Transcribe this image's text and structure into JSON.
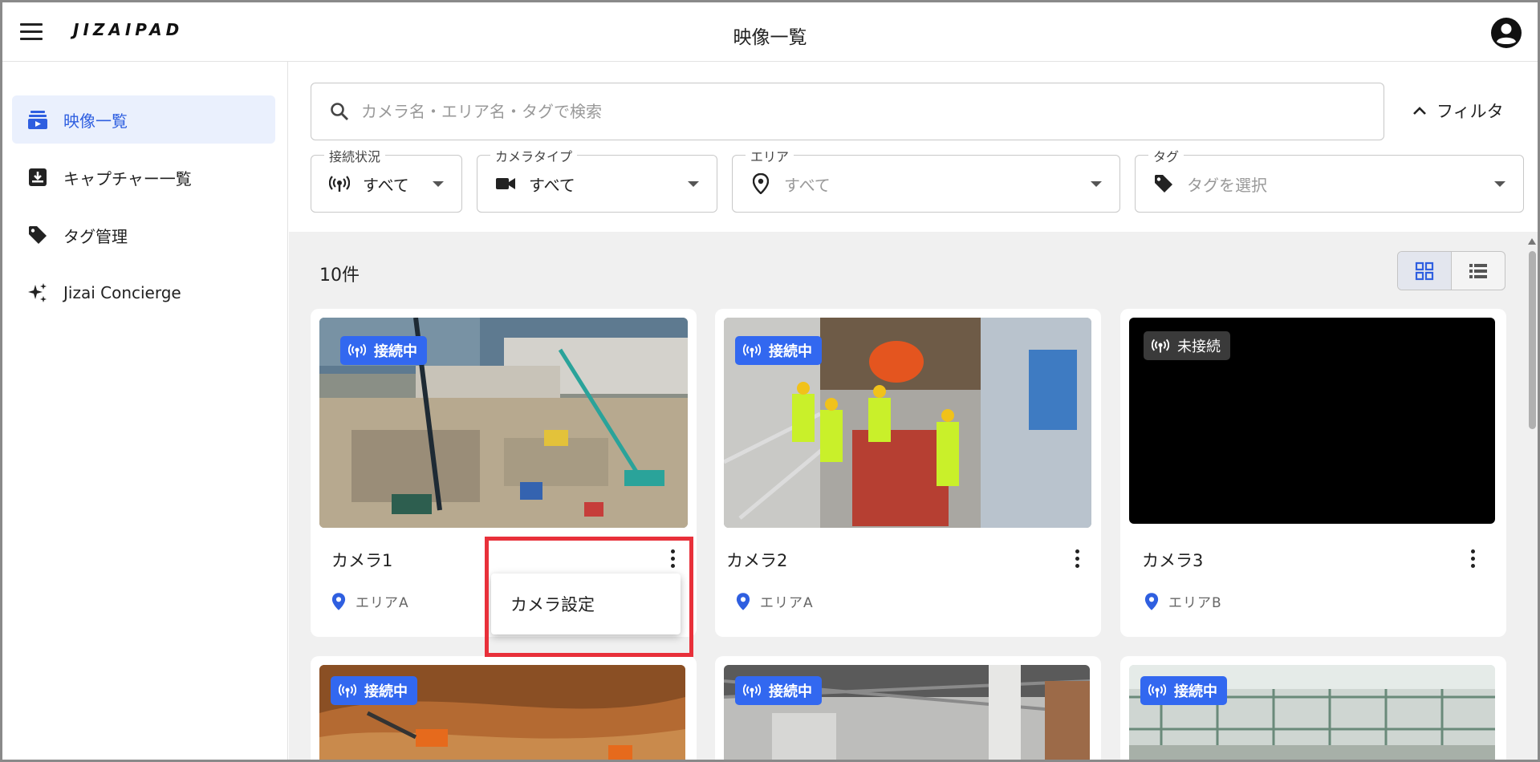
{
  "header": {
    "logo": "JIZAIPAD",
    "title": "映像一覧"
  },
  "sidebar": {
    "items": [
      {
        "label": "映像一覧",
        "icon": "video-list-icon",
        "active": true
      },
      {
        "label": "キャプチャー一覧",
        "icon": "capture-icon",
        "active": false
      },
      {
        "label": "タグ管理",
        "icon": "tag-icon",
        "active": false
      },
      {
        "label": "Jizai Concierge",
        "icon": "sparkle-icon",
        "active": false
      }
    ]
  },
  "search": {
    "placeholder": "カメラ名・エリア名・タグで検索",
    "value": ""
  },
  "filter_toggle": {
    "label": "フィルタ"
  },
  "filters": [
    {
      "legend": "接続状況",
      "value": "すべて",
      "icon": "broadcast-icon"
    },
    {
      "legend": "カメラタイプ",
      "value": "すべて",
      "icon": "video-camera-icon"
    },
    {
      "legend": "エリア",
      "value": "すべて",
      "icon": "location-pin-icon"
    },
    {
      "legend": "タグ",
      "value": "タグを選択",
      "icon": "tag-icon"
    }
  ],
  "results": {
    "count_label": "10件"
  },
  "cards": [
    {
      "name": "カメラ1",
      "area": "エリアA",
      "status": "接続中"
    },
    {
      "name": "カメラ2",
      "area": "エリアA",
      "status": "接続中"
    },
    {
      "name": "カメラ3",
      "area": "エリアB",
      "status": "未接続"
    },
    {
      "name": "",
      "area": "",
      "status": "接続中"
    },
    {
      "name": "",
      "area": "",
      "status": "接続中"
    },
    {
      "name": "",
      "area": "",
      "status": "接続中"
    }
  ],
  "context_menu": {
    "items": [
      {
        "label": "カメラ設定"
      }
    ]
  },
  "colors": {
    "accent": "#3268f0",
    "highlight": "#e8303a",
    "active_nav_bg": "#eaf0fd"
  }
}
